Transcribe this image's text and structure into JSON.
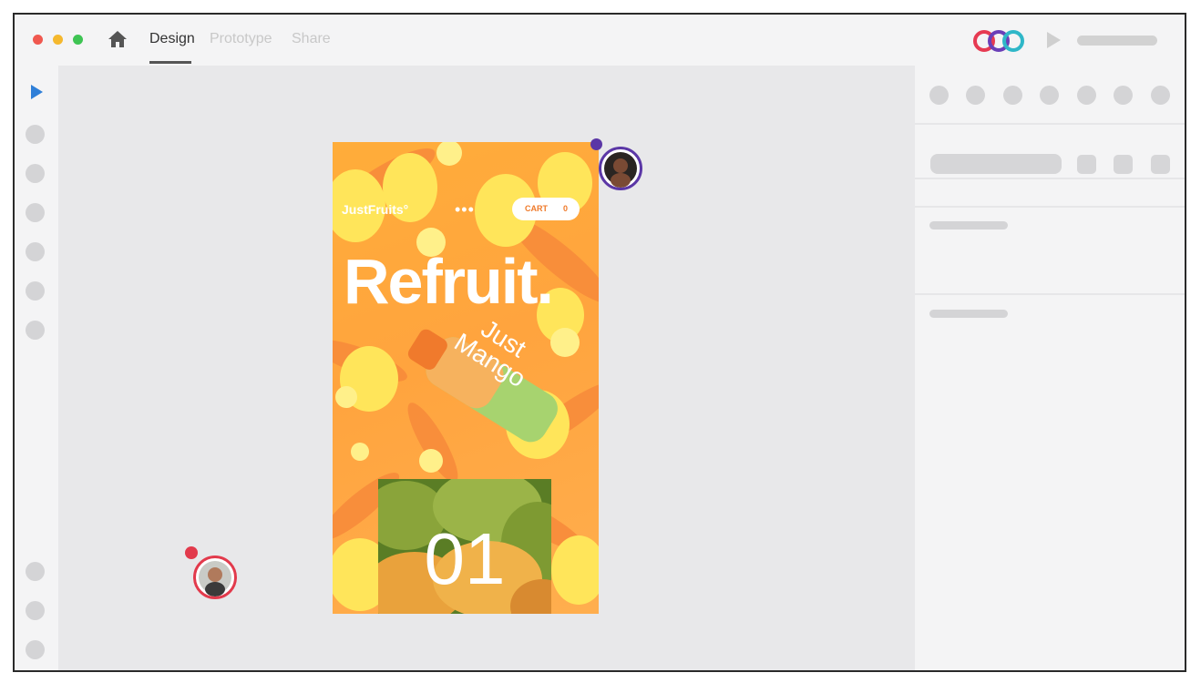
{
  "window": {
    "traffic_lights": {
      "close": "#f0584f",
      "minimize": "#f5b82e",
      "zoom": "#3ec453"
    },
    "home_icon": "home-icon",
    "tabs": [
      {
        "label": "Design",
        "active": true
      },
      {
        "label": "Prototype",
        "active": false
      },
      {
        "label": "Share",
        "active": false
      }
    ],
    "logo_colors": [
      "#e63a52",
      "#6a3fb8",
      "#2fb7c8"
    ]
  },
  "toolbar": {
    "select_icon": "select-arrow-icon",
    "select_color": "#2f7fd8",
    "tool_slots": 9
  },
  "artboard": {
    "brand": "JustFruits°",
    "menu": "•••",
    "cart": {
      "label": "CART",
      "count": "0"
    },
    "headline": "Refruit.",
    "bottle_text": "Just Mango",
    "tile_number": "01",
    "colors": {
      "primary": "#ffa43e",
      "accent": "#ffe55a",
      "cart_text": "#ef7a2a"
    }
  },
  "collaborators": [
    {
      "name": "collaborator-1",
      "ring": "#5b37a6"
    },
    {
      "name": "collaborator-2",
      "ring": "#e23a4c"
    }
  ]
}
